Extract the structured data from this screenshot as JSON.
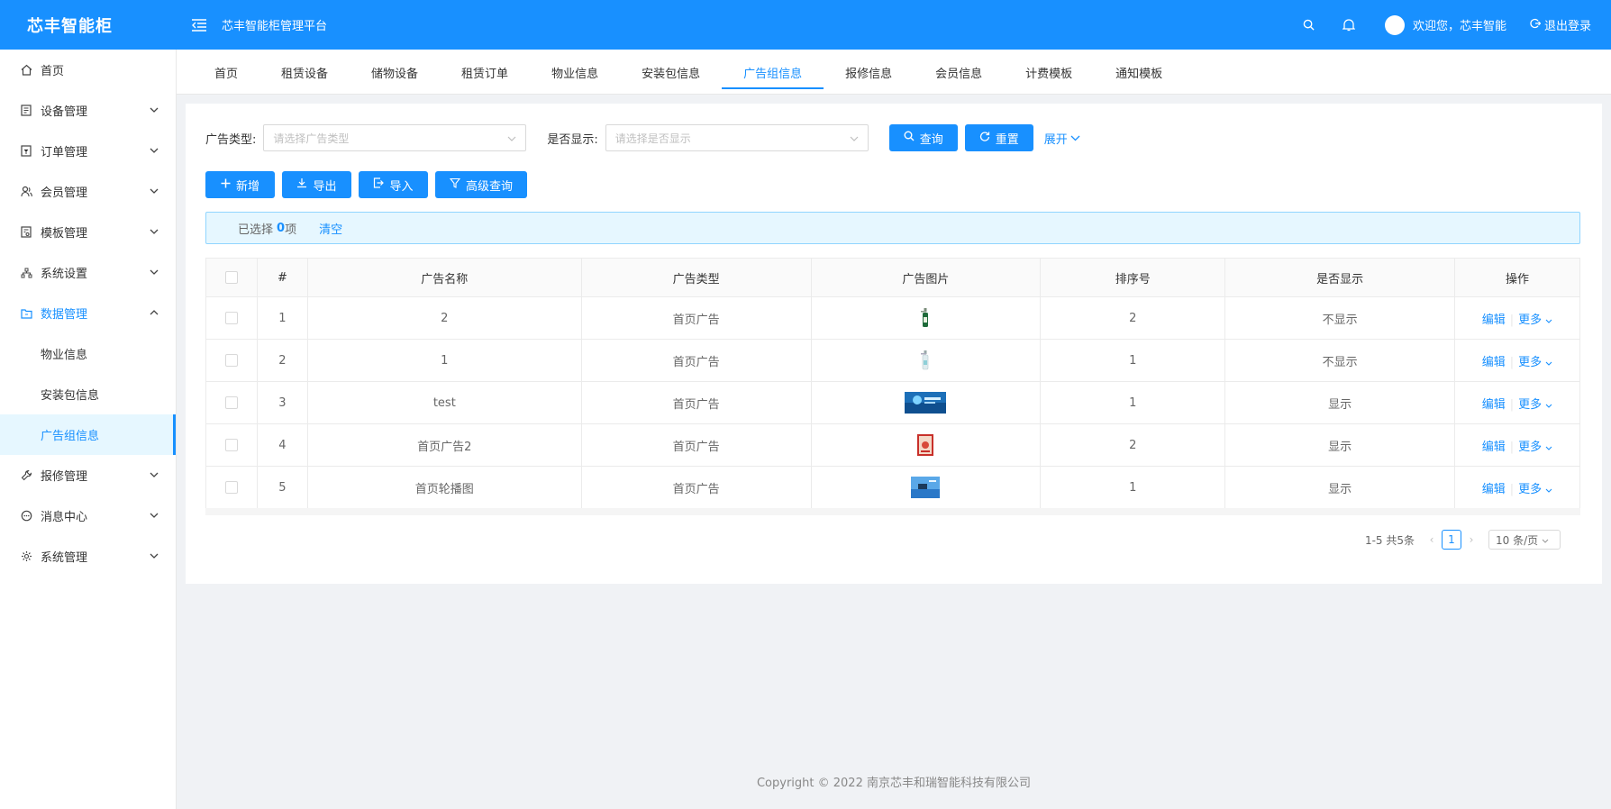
{
  "app": {
    "logo": "芯丰智能柜",
    "title": "芯丰智能柜管理平台",
    "welcome": "欢迎您，芯丰智能",
    "logout": "退出登录"
  },
  "sidebar": {
    "items": [
      {
        "label": "首页",
        "icon": "home-icon"
      },
      {
        "label": "设备管理",
        "icon": "device-icon"
      },
      {
        "label": "订单管理",
        "icon": "order-icon"
      },
      {
        "label": "会员管理",
        "icon": "members-icon"
      },
      {
        "label": "模板管理",
        "icon": "template-icon"
      },
      {
        "label": "系统设置",
        "icon": "sitemap-icon"
      },
      {
        "label": "数据管理",
        "icon": "folder-icon"
      },
      {
        "label": "物业信息"
      },
      {
        "label": "安装包信息"
      },
      {
        "label": "广告组信息"
      },
      {
        "label": "报修管理",
        "icon": "wrench-icon"
      },
      {
        "label": "消息中心",
        "icon": "message-icon"
      },
      {
        "label": "系统管理",
        "icon": "settings-icon"
      }
    ]
  },
  "tabs": [
    "首页",
    "租赁设备",
    "储物设备",
    "租赁订单",
    "物业信息",
    "安装包信息",
    "广告组信息",
    "报修信息",
    "会员信息",
    "计费模板",
    "通知模板"
  ],
  "filters": {
    "type_label": "广告类型:",
    "type_placeholder": "请选择广告类型",
    "show_label": "是否显示:",
    "show_placeholder": "请选择是否显示",
    "query": "查询",
    "reset": "重置",
    "expand": "展开"
  },
  "toolbar": {
    "add": "新增",
    "export": "导出",
    "import": "导入",
    "advanced": "高级查询"
  },
  "selection": {
    "prefix": "已选择",
    "count": "0",
    "suffix": "项",
    "clear": "清空"
  },
  "table": {
    "headers": [
      "#",
      "广告名称",
      "广告类型",
      "广告图片",
      "排序号",
      "是否显示",
      "操作"
    ],
    "rows": [
      {
        "idx": "1",
        "name": "2",
        "type": "首页广告",
        "image": "bottle-green",
        "order": "2",
        "show": "不显示"
      },
      {
        "idx": "2",
        "name": "1",
        "type": "首页广告",
        "image": "bottle-clear",
        "order": "1",
        "show": "不显示"
      },
      {
        "idx": "3",
        "name": "test",
        "type": "首页广告",
        "image": "banner-blue",
        "order": "1",
        "show": "显示"
      },
      {
        "idx": "4",
        "name": "首页广告2",
        "type": "首页广告",
        "image": "poster-red",
        "order": "2",
        "show": "显示"
      },
      {
        "idx": "5",
        "name": "首页轮播图",
        "type": "首页广告",
        "image": "banner-sky",
        "order": "1",
        "show": "显示"
      }
    ],
    "edit": "编辑",
    "more": "更多"
  },
  "pagination": {
    "summary": "1-5 共5条",
    "current": "1",
    "page_size": "10 条/页"
  },
  "footer": "Copyright © 2022 南京芯丰和瑞智能科技有限公司"
}
